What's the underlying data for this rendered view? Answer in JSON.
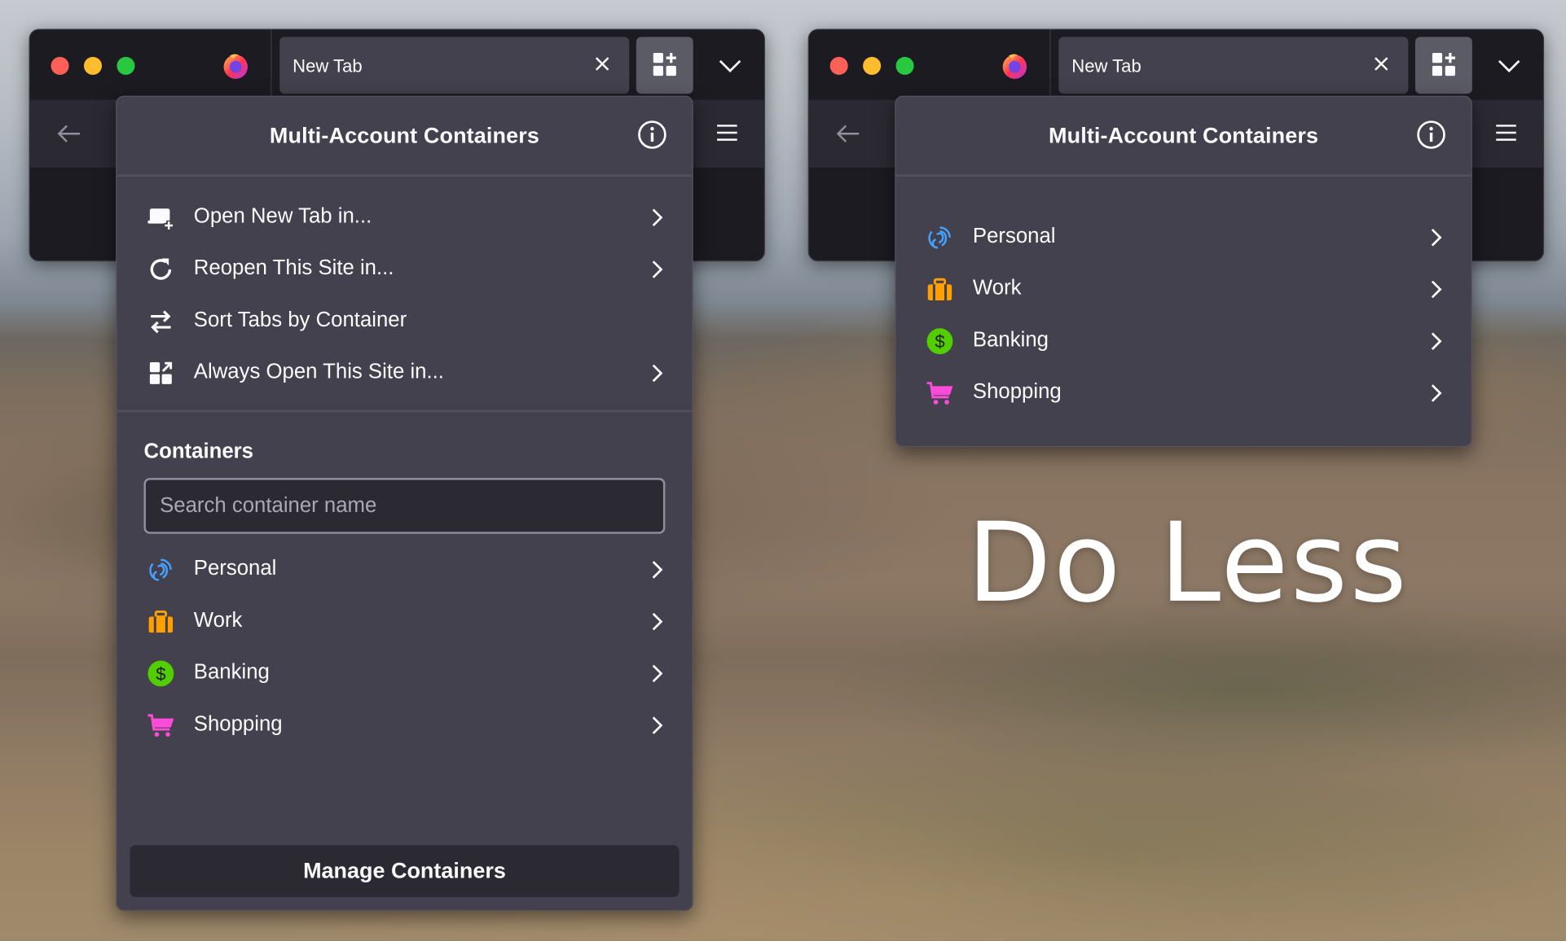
{
  "colors": {
    "personal": "#45a1ff",
    "work": "#ff9f00",
    "banking": "#51cd00",
    "shopping": "#ff4bda",
    "panel_bg": "#42414d",
    "toolbar_bg": "#2b2a33",
    "frame_bg": "#1c1b22"
  },
  "left_window": {
    "tab_title": "New Tab",
    "panel": {
      "title": "Multi-Account Containers",
      "actions": [
        {
          "label": "Open New Tab in...",
          "icon": "new-tab-icon",
          "has_submenu": true
        },
        {
          "label": "Reopen This Site in...",
          "icon": "reload-icon",
          "has_submenu": true
        },
        {
          "label": "Sort Tabs by Container",
          "icon": "sort-icon",
          "has_submenu": false
        },
        {
          "label": "Always Open This Site in...",
          "icon": "container-grid-icon",
          "has_submenu": true
        }
      ],
      "containers_heading": "Containers",
      "search_placeholder": "Search container name",
      "containers": [
        {
          "label": "Personal",
          "icon": "fingerprint-icon",
          "color": "#45a1ff"
        },
        {
          "label": "Work",
          "icon": "briefcase-icon",
          "color": "#ff9f00"
        },
        {
          "label": "Banking",
          "icon": "dollar-icon",
          "color": "#51cd00"
        },
        {
          "label": "Shopping",
          "icon": "cart-icon",
          "color": "#ff4bda"
        }
      ],
      "manage_button": "Manage Containers"
    }
  },
  "right_window": {
    "tab_title": "New Tab",
    "panel": {
      "title": "Multi-Account Containers",
      "containers": [
        {
          "label": "Personal",
          "icon": "fingerprint-icon",
          "color": "#45a1ff"
        },
        {
          "label": "Work",
          "icon": "briefcase-icon",
          "color": "#ff9f00"
        },
        {
          "label": "Banking",
          "icon": "dollar-icon",
          "color": "#51cd00"
        },
        {
          "label": "Shopping",
          "icon": "cart-icon",
          "color": "#ff4bda"
        }
      ]
    }
  },
  "wallpaper_text": "Do Less"
}
